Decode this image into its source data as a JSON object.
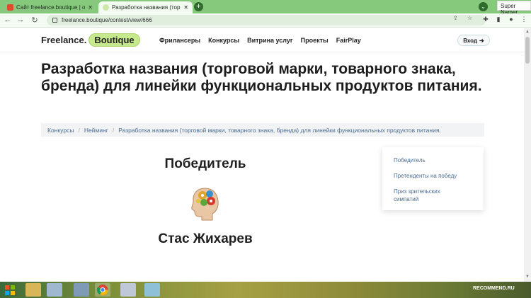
{
  "browser": {
    "tabs": [
      {
        "title": "Сайт freelance.boutique | отзывы",
        "active": false
      },
      {
        "title": "Разработка названия (торговой",
        "active": true
      }
    ],
    "new_tab": "+",
    "tab_search": "⌄",
    "profile_name": "Super Namer",
    "url": "freelance.boutique/contest/view/666"
  },
  "site": {
    "logo_text": "Freelance.",
    "logo_pill": "Boutique",
    "nav": [
      "Фрилансеры",
      "Конкурсы",
      "Витрина услуг",
      "Проекты",
      "FairPlay"
    ],
    "login_label": "Вход"
  },
  "page": {
    "title": "Разработка названия (торговой марки, товарного знака, бренда) для линейки функциональных продуктов питания.",
    "breadcrumb": [
      "Конкурсы",
      "Нейминг",
      "Разработка названия (торговой марки, товарного знака, бренда) для линейки функциональных продуктов питания."
    ],
    "winner_heading": "Победитель",
    "winner_name": "Стас Жихарев",
    "side_links": [
      "Победитель",
      "Претенденты на победу",
      "Приз зрительских симпатий"
    ]
  },
  "taskbar": {
    "watermark": "RECOMMEND.RU"
  },
  "colors": {
    "tabstrip": "#86c97d",
    "logo_pill": "#c5e98c",
    "link": "#4a6b8f"
  }
}
